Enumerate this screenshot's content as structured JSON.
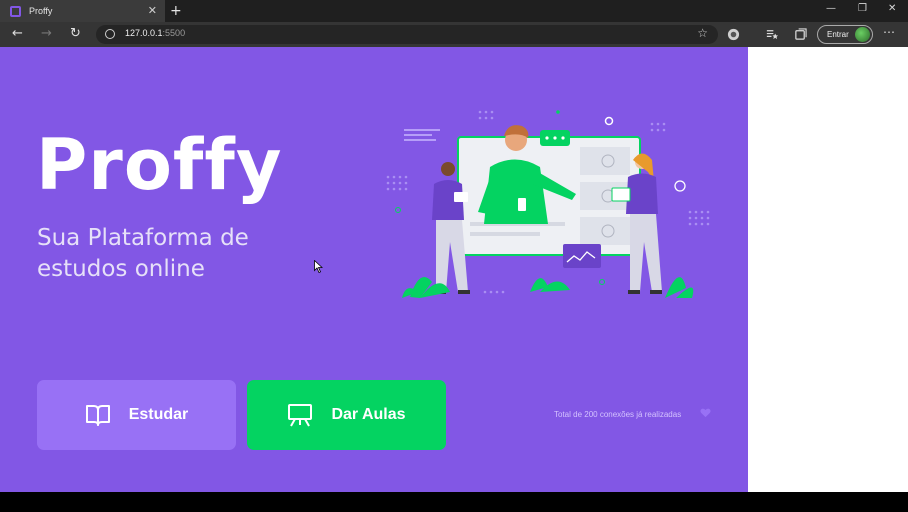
{
  "browser": {
    "tab_title": "Proffy",
    "url_host": "127.0.0.1",
    "url_port": ":5500",
    "login_label": "Entrar",
    "colors": {
      "tabbar": "#1f1f1f",
      "active_tab": "#3b3b3b",
      "addressbar": "#353535"
    }
  },
  "page": {
    "logo_text": "Proffy",
    "tagline": "Sua Plataforma de estudos online",
    "buttons": {
      "study_label": "Estudar",
      "teach_label": "Dar Aulas"
    },
    "total_connections_text": "Total de 200 conexões já realizadas",
    "icons": [
      "book-icon",
      "presentation-board-icon",
      "heart-icon"
    ],
    "colors": {
      "background": "#8257e5",
      "study_button": "#9871f5",
      "teach_button": "#04d361",
      "text_light": "#d4c2ff"
    }
  }
}
